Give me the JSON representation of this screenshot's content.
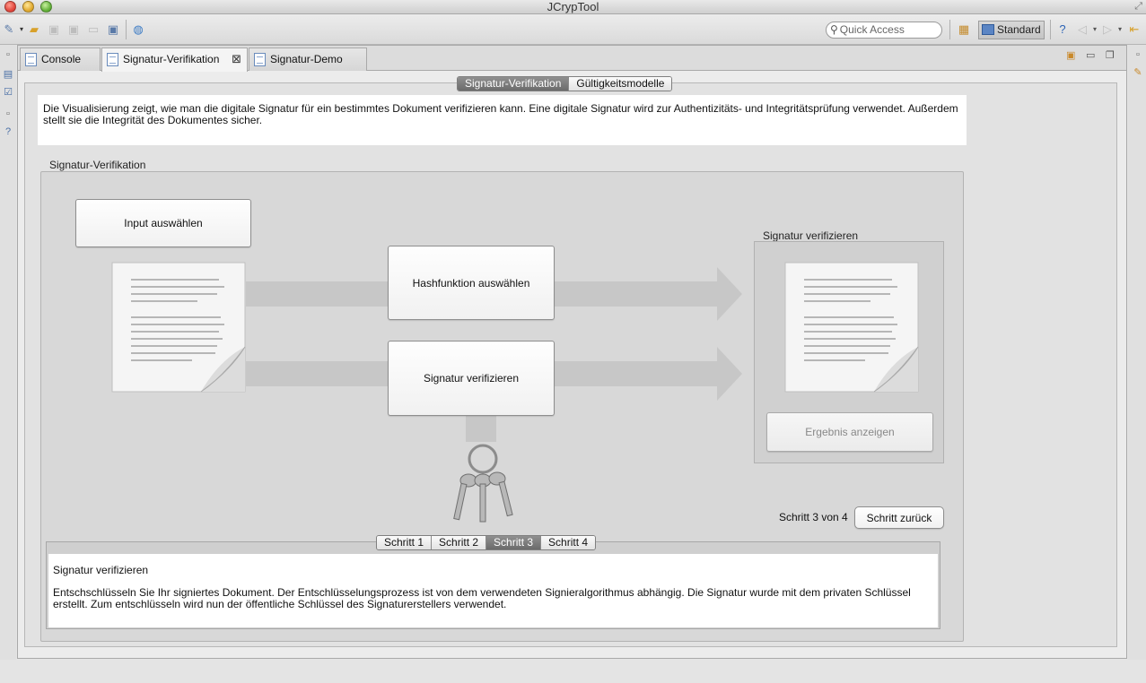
{
  "window": {
    "title": "JCrypTool"
  },
  "toolbar": {
    "quick_access_placeholder": "Quick Access",
    "perspective_label": "Standard"
  },
  "tabs": [
    {
      "label": "Console"
    },
    {
      "label": "Signatur-Verifikation"
    },
    {
      "label": "Signatur-Demo"
    }
  ],
  "view_switch": {
    "options": [
      "Signatur-Verifikation",
      "Gültigkeitsmodelle"
    ],
    "selected": "Signatur-Verifikation"
  },
  "intro_text": "Die Visualisierung zeigt, wie man die digitale Signatur für ein bestimmtes Dokument verifizieren kann. Eine digitale Signatur wird zur Authentizitäts- und Integritätsprüfung verwendet. Außerdem stellt sie die Integrität des Dokumentes sicher.",
  "group": {
    "label": "Signatur-Verifikation",
    "input_button": "Input auswählen",
    "hash_button": "Hashfunktion auswählen",
    "verify_button": "Signatur verifizieren",
    "result_group_label": "Signatur verifizieren",
    "result_button": "Ergebnis anzeigen",
    "step_counter": "Schritt 3 von 4",
    "back_button": "Schritt zurück"
  },
  "steps": {
    "options": [
      "Schritt 1",
      "Schritt 2",
      "Schritt 3",
      "Schritt 4"
    ],
    "selected": "Schritt 3"
  },
  "description": {
    "title": "Signatur verifizieren",
    "body": "Entschschlüsseln Sie Ihr signiertes Dokument. Der Entschlüsselungsprozess ist von dem verwendeten Signieralgorithmus abhängig. Die Signatur wurde mit dem privaten Schlüssel erstellt. Zum entschlüsseln wird nun der öffentliche Schlüssel des Signaturerstellers verwendet."
  },
  "colors": {
    "segment_selected": "#7a7a7a",
    "panel_bg": "#d8d8d8",
    "arrow": "#c7c7c7"
  }
}
